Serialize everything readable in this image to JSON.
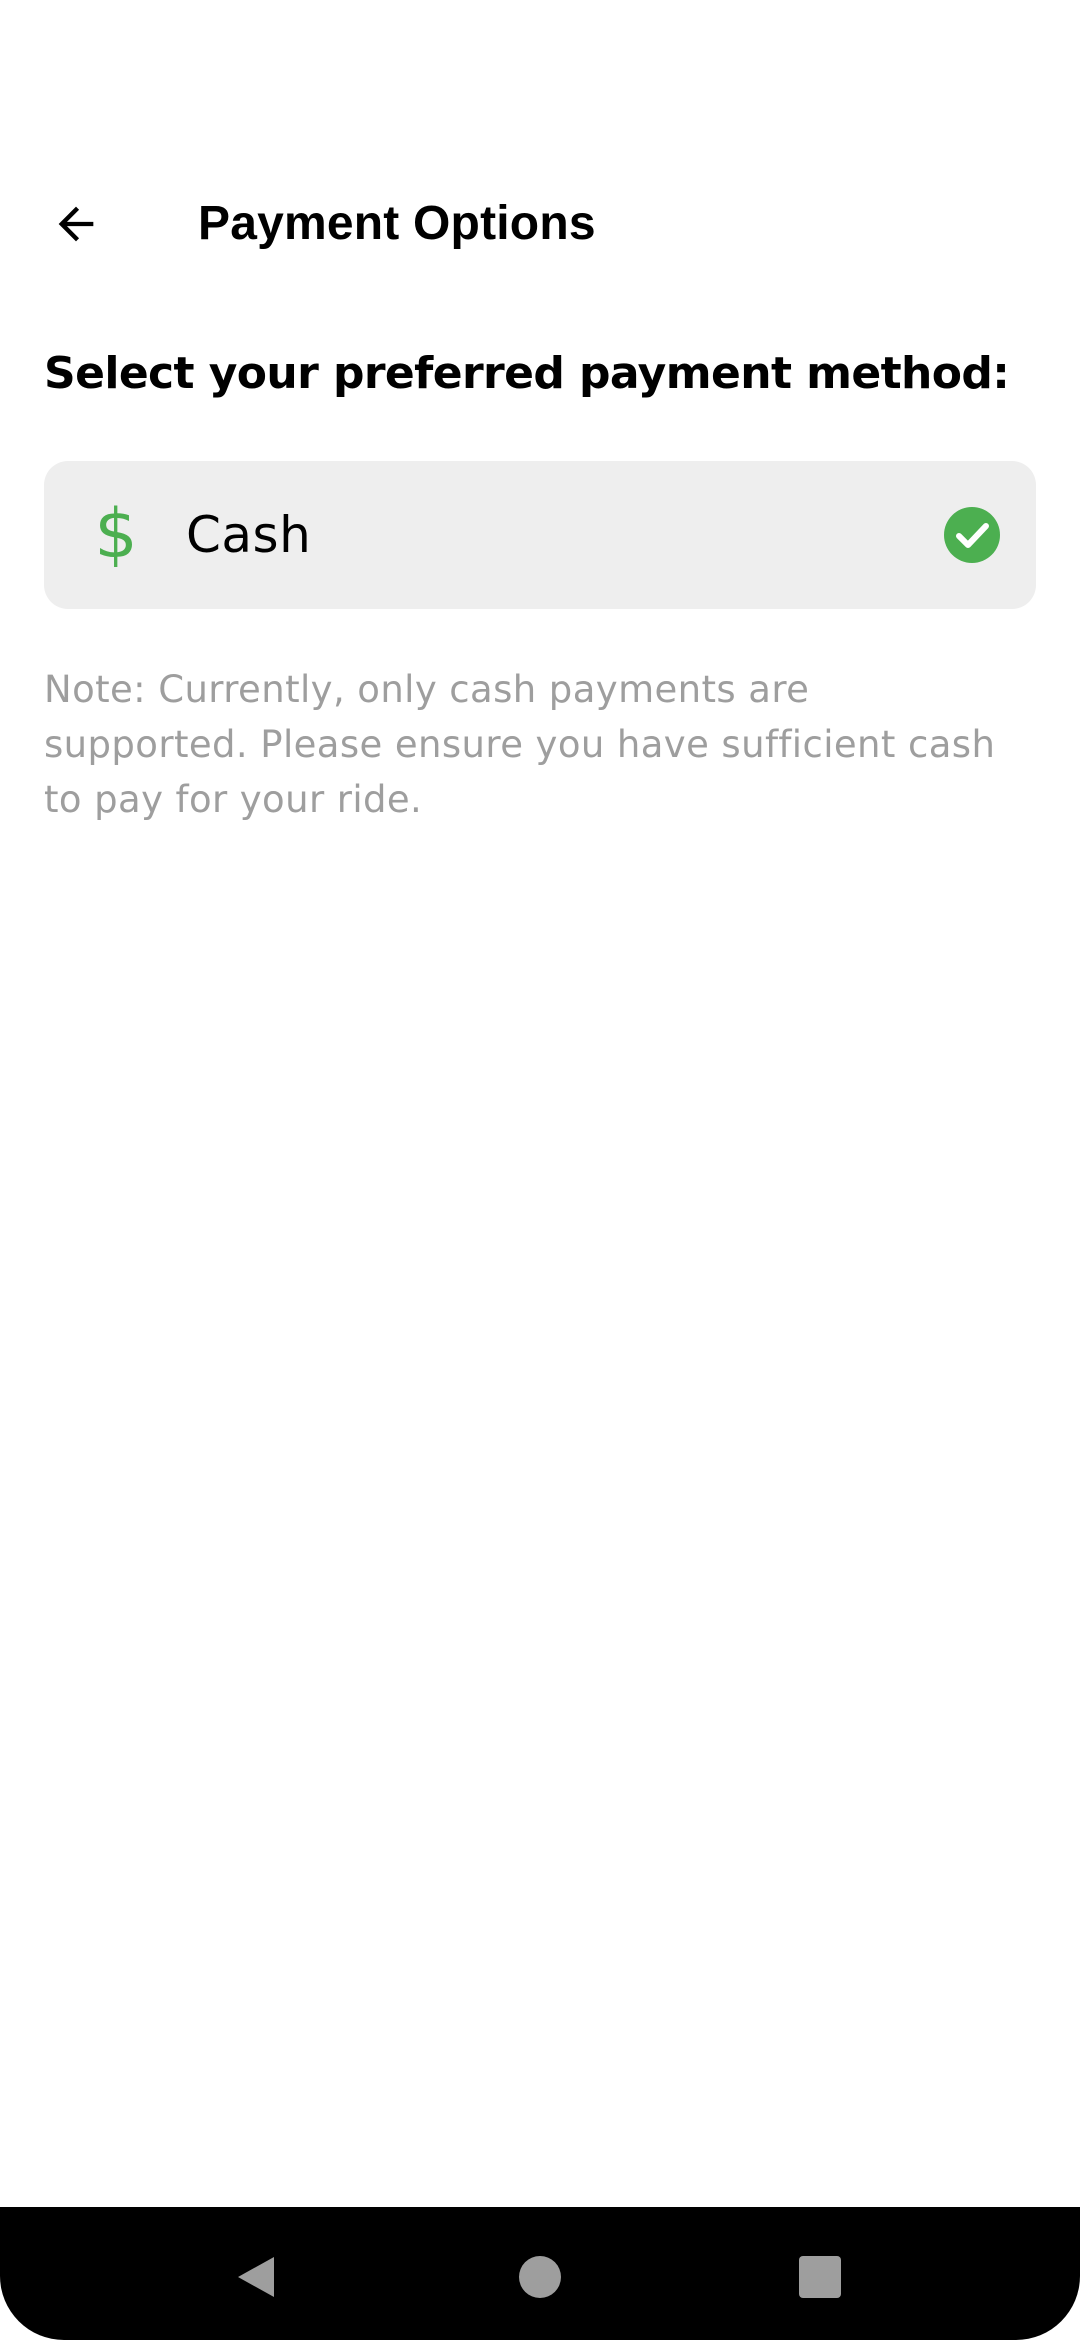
{
  "header": {
    "title": "Payment Options",
    "back_icon": "arrow-back-icon"
  },
  "section": {
    "heading": "Select your preferred payment method:"
  },
  "payment_methods": [
    {
      "label": "Cash",
      "icon": "dollar-icon",
      "icon_glyph": "$",
      "selected": true,
      "selected_icon": "check-circle-icon"
    }
  ],
  "note": "Note: Currently, only cash payments are supported. Please ensure you have sufficient cash to pay for your ride.",
  "colors": {
    "accent_green": "#4caf50",
    "option_background": "#eeeeee",
    "note_text": "#9e9e9e",
    "nav_bar": "#000000",
    "nav_icon": "#9e9e9e"
  },
  "system_nav": {
    "back_icon": "triangle-back-icon",
    "home_icon": "circle-home-icon",
    "recents_icon": "square-recents-icon"
  }
}
